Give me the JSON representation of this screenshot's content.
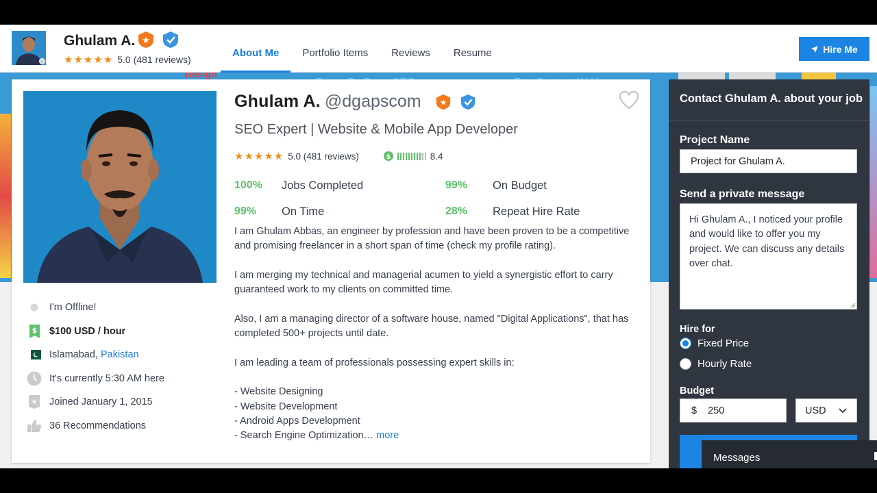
{
  "header": {
    "name": "Ghulam A.",
    "rating_stars": "★★★★★",
    "rating_text": "5.0 (481 reviews)",
    "tabs": [
      {
        "label": "About Me",
        "active": true
      },
      {
        "label": "Portfolio Items",
        "active": false
      },
      {
        "label": "Reviews",
        "active": false
      },
      {
        "label": "Resume",
        "active": false
      }
    ],
    "hire_label": "Hire Me"
  },
  "banner": {
    "texts": [
      "Design",
      "Ecom Op Page SEO",
      "Exp Content Writing"
    ]
  },
  "profile": {
    "name": "Ghulam A.",
    "handle": "@dgapscom",
    "tagline": "SEO Expert | Website & Mobile App Developer",
    "rating_stars": "★★★★★",
    "rating_text": "5.0 (481 reviews)",
    "score": "8.4",
    "score_fraction": 0.84,
    "stats": [
      {
        "pct": "100%",
        "label": "Jobs Completed"
      },
      {
        "pct": "99%",
        "label": "On Budget"
      },
      {
        "pct": "99%",
        "label": "On Time"
      },
      {
        "pct": "28%",
        "label": "Repeat Hire Rate"
      }
    ],
    "bio": [
      "I am Ghulam Abbas, an engineer by profession and have been proven to be a competitive and promising freelancer in a short span of time (check my profile rating).",
      "I am merging my technical and managerial acumen to yield a synergistic effort to carry guaranteed work to my clients on committed time.",
      "Also, I am a managing director of a software house, named \"Digital Applications\", that has completed 500+ projects until date.",
      "I am leading a team of professionals possessing expert skills in:"
    ],
    "skills": [
      "- Website Designing",
      "- Website Development",
      "- Android Apps Development",
      "- Search Engine Optimization…"
    ],
    "more_label": "more",
    "side": {
      "status": "I'm Offline!",
      "rate": "$100 USD / hour",
      "city": "Islamabad,",
      "country": "Pakistan",
      "time": "It's currently 5:30 AM here",
      "joined": "Joined January 1, 2015",
      "recommendations": "36 Recommendations"
    }
  },
  "contact": {
    "title": "Contact Ghulam A. about your job",
    "project_label": "Project Name",
    "project_value": "Project for Ghulam A.",
    "message_label": "Send a private message",
    "message_value": "Hi Ghulam A., I noticed your profile and would like to offer you my project. We can discuss any details over chat.",
    "hire_for_label": "Hire for",
    "options": [
      {
        "label": "Fixed Price",
        "selected": true
      },
      {
        "label": "Hourly Rate",
        "selected": false
      }
    ],
    "budget_label": "Budget",
    "currency_symbol": "$",
    "budget_value": "250",
    "currency": "USD"
  },
  "messages_label": "Messages",
  "colors": {
    "accent": "#1c84e3",
    "success": "#5dc26a",
    "star": "#f28c1a",
    "panel": "#2f3640"
  }
}
